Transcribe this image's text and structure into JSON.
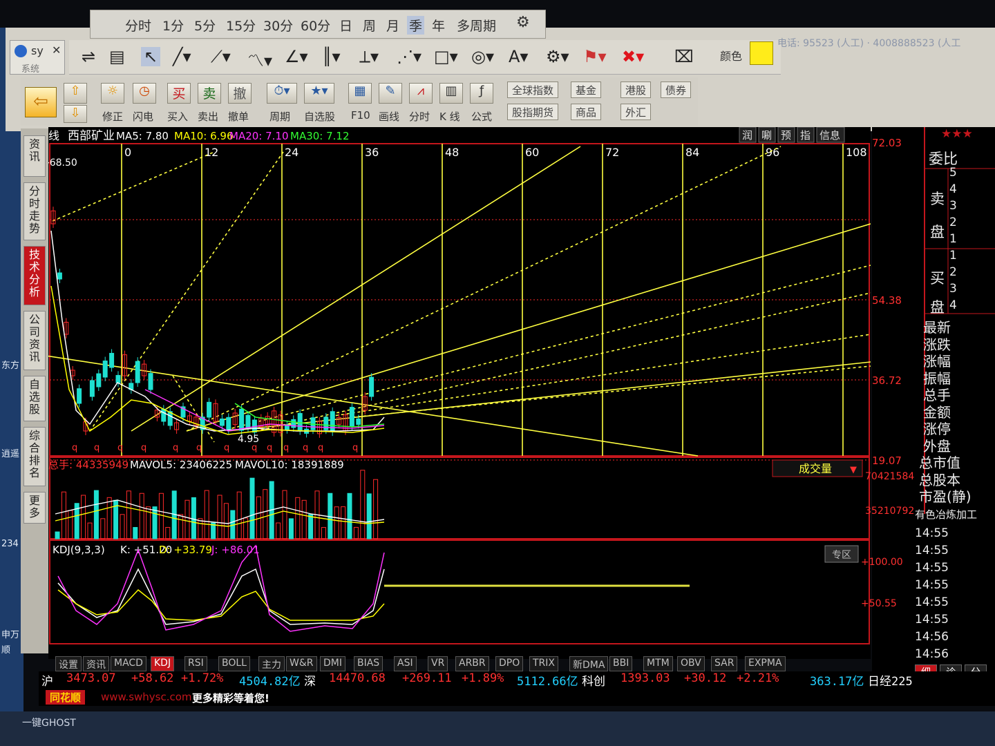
{
  "period_bar": [
    "分时",
    "1分",
    "5分",
    "15分",
    "30分",
    "60分",
    "日",
    "周",
    "月",
    "季",
    "年",
    "多周期"
  ],
  "active_period": "季",
  "app": {
    "tab_label": "sy",
    "sys_label": "系统"
  },
  "phone": "电话: 95523 (人工) · 4008888523 (人工",
  "color_label": "颜色",
  "toolbar2": {
    "labels": [
      "修正",
      "闪电",
      "买入",
      "卖出",
      "撤单",
      "周期",
      "自选股",
      "F10",
      "画线",
      "分时",
      "K 线",
      "公式"
    ],
    "buy": "买",
    "sell": "卖",
    "cancel": "撤"
  },
  "markets": [
    "全球指数",
    "基金",
    "港股",
    "债券",
    "股指期货",
    "商品",
    "外汇"
  ],
  "vtabs": [
    "资讯",
    "分时走势",
    "技术分析",
    "公司资讯",
    "自选股",
    "综合排名",
    "更多"
  ],
  "header": {
    "period": "季线",
    "stock": "西部矿业",
    "ma5": "MA5: 7.80",
    "ma10": "MA10: 6.96",
    "ma20": "MA20: 7.10",
    "ma30": "MA30: 7.12",
    "high_marker": "←68.50",
    "buttons": [
      "润",
      "唰",
      "预",
      "指",
      "信息"
    ]
  },
  "fib_labels": [
    "0",
    "12",
    "24",
    "36",
    "48",
    "60",
    "72",
    "84",
    "96",
    "108"
  ],
  "price_axis": [
    "72.03",
    "54.38",
    "36.72",
    "19.07"
  ],
  "low_marker": "4.95",
  "volume": {
    "title": "总手: 44335949",
    "mavol5": "MAVOL5: 23406225",
    "mavol10": "MAVOL10: 18391889",
    "selector": "成交量",
    "axis": [
      "70421584",
      "35210792"
    ]
  },
  "kdj": {
    "title": "KDJ(9,3,3)",
    "k": "K: +51.20",
    "d": "D: +33.79",
    "j": "J: +86.01",
    "axis": [
      "+100.00",
      "+50.55"
    ],
    "zone_btn": "专区"
  },
  "right": {
    "weibi": "委比",
    "sell_label": "卖盘",
    "buy_label": "买盘",
    "sell_levels": [
      "5",
      "4",
      "3",
      "2",
      "1"
    ],
    "buy_levels": [
      "1",
      "2",
      "3",
      "4"
    ],
    "fields": [
      "最新",
      "涨跌",
      "涨幅",
      "振幅",
      "总手",
      "金额",
      "涨停",
      "外盘",
      "总市值",
      "总股本",
      "市盈(静)"
    ],
    "industry": "有色冶炼加工",
    "times": [
      "14:55",
      "14:55",
      "14:55",
      "14:55",
      "14:55",
      "14:55",
      "14:56",
      "14:56"
    ],
    "bottom_tabs": [
      "细",
      "诊",
      "分"
    ]
  },
  "indicator_tabs": [
    "设置",
    "资讯",
    "MACD",
    "KDJ",
    "RSI",
    "BOLL",
    "主力",
    "W&R",
    "DMI",
    "BIAS",
    "ASI",
    "VR",
    "ARBR",
    "DPO",
    "TRIX",
    "新DMA",
    "BBI",
    "MTM",
    "OBV",
    "SAR",
    "EXPMA"
  ],
  "active_indicator": "KDJ",
  "ticker": {
    "sh": "沪",
    "sh_val": "3473.07",
    "sh_chg": "+58.62",
    "sh_pct": "+1.72%",
    "sh_amt": "4504.82亿",
    "sz": "深",
    "sz_val": "14470.68",
    "sz_chg": "+269.11",
    "sz_pct": "+1.89%",
    "sz_amt": "5112.66亿",
    "kc": "科创",
    "kc_val": "1393.03",
    "kc_chg": "+30.12",
    "kc_pct": "+2.21%",
    "kc_amt": "363.17亿",
    "nk": "日经225"
  },
  "ad": {
    "brand": "同花顺",
    "url": "www.swhysc.com",
    "slogan": "更多精彩等着您!"
  },
  "taskbar": "一键GHOST",
  "desktop_labels": [
    "东方",
    "逍遥",
    "234",
    "申万",
    "顺"
  ],
  "colors": {
    "up": "#ff2a2a",
    "down": "#1ee0d0",
    "grid": "#ff2a2a",
    "fib": "#ffff40",
    "ma5": "#ffffff",
    "ma10": "#ffff00",
    "ma20": "#ff33ff",
    "ma30": "#33ff33"
  }
}
